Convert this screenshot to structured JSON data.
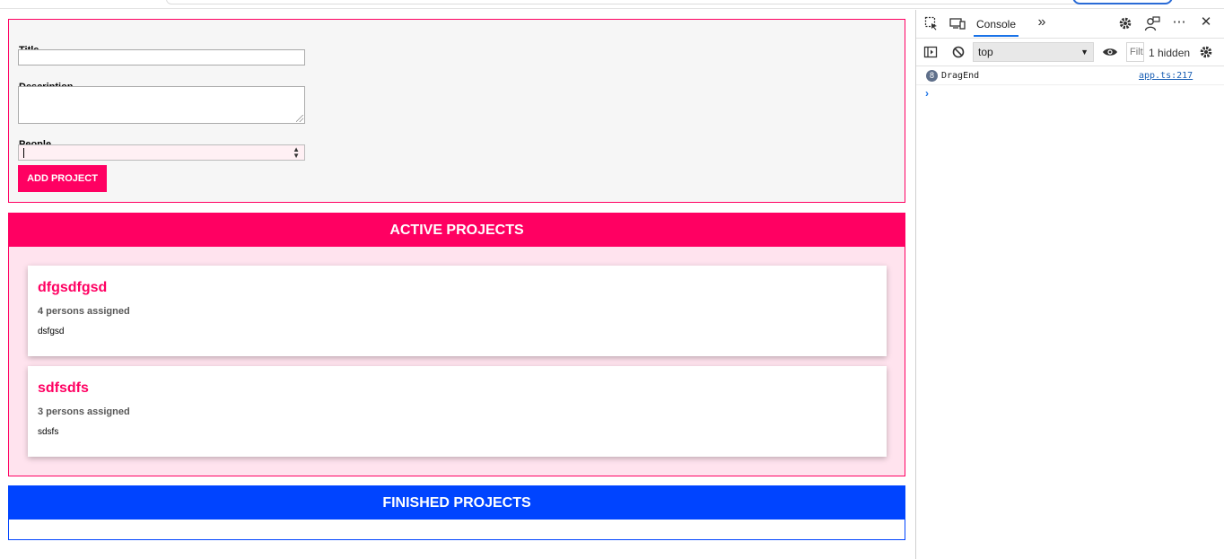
{
  "form": {
    "title_label": "Title",
    "title_value": "",
    "description_label": "Description",
    "description_value": "",
    "people_label": "People",
    "people_value": "",
    "submit_label": "ADD PROJECT"
  },
  "active": {
    "heading": "ACTIVE PROJECTS",
    "projects": [
      {
        "title": "dfgsdfgsd",
        "assigned": "4 persons assigned",
        "description": "dsfgsd"
      },
      {
        "title": "sdfsdfs",
        "assigned": "3 persons assigned",
        "description": "sdsfs"
      }
    ]
  },
  "finished": {
    "heading": "FINISHED PROJECTS",
    "projects": []
  },
  "devtools": {
    "tab_console": "Console",
    "more_tabs": "»",
    "context": "top",
    "filter_placeholder": "Filt",
    "hidden": "1 hidden",
    "log": {
      "count": "8",
      "message": "DragEnd",
      "source": "app.ts:217"
    },
    "prompt": "›",
    "icons": [
      "inspect-icon",
      "device-toggle-icon",
      "more-tabs-icon",
      "settings-icon",
      "feedback-icon",
      "more-options-icon",
      "close-icon",
      "sidebar-toggle-icon",
      "clear-console-icon",
      "eye-icon",
      "console-settings-icon"
    ]
  },
  "colors": {
    "accent": "#ff0062",
    "finished": "#0044ff",
    "active_bg": "#ffe3ee",
    "form_bg": "#f6f6f6"
  }
}
